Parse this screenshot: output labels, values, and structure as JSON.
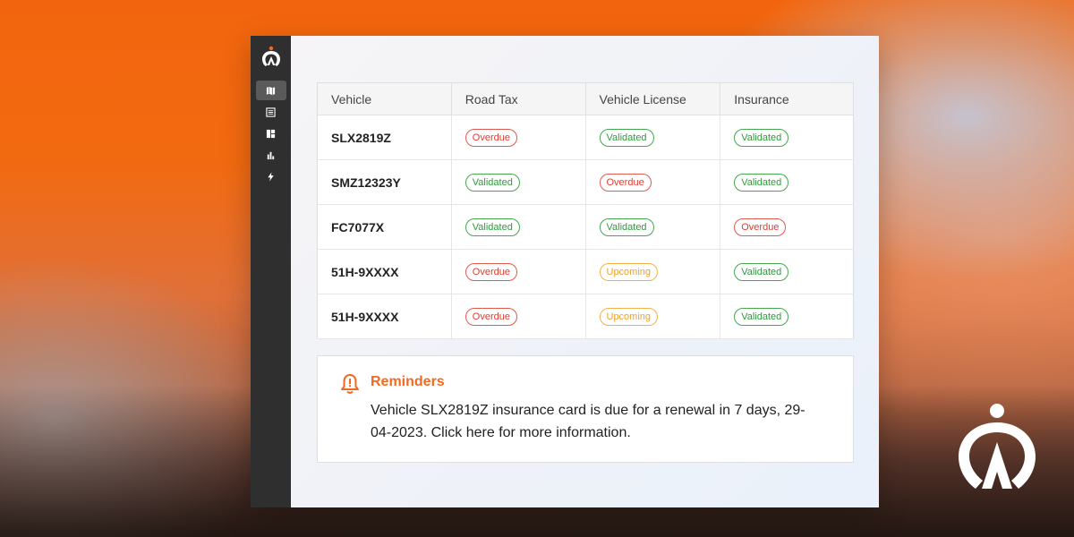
{
  "sidebar": {
    "logo_icon": "app-logo-icon",
    "items": [
      {
        "icon": "map-icon",
        "active": true
      },
      {
        "icon": "list-icon",
        "active": false
      },
      {
        "icon": "dashboard-icon",
        "active": false
      },
      {
        "icon": "bar-chart-icon",
        "active": false
      },
      {
        "icon": "lightning-icon",
        "active": false
      }
    ]
  },
  "table": {
    "headers": [
      "Vehicle",
      "Road Tax",
      "Vehicle License",
      "Insurance"
    ],
    "rows": [
      {
        "vehicle": "SLX2819Z",
        "road_tax": "Overdue",
        "vehicle_license": "Validated",
        "insurance": "Validated"
      },
      {
        "vehicle": "SMZ12323Y",
        "road_tax": "Validated",
        "vehicle_license": "Overdue",
        "insurance": "Validated"
      },
      {
        "vehicle": "FC7077X",
        "road_tax": "Validated",
        "vehicle_license": "Validated",
        "insurance": "Overdue"
      },
      {
        "vehicle": "51H-9XXXX",
        "road_tax": "Overdue",
        "vehicle_license": "Upcoming",
        "insurance": "Validated"
      },
      {
        "vehicle": "51H-9XXXX",
        "road_tax": "Overdue",
        "vehicle_license": "Upcoming",
        "insurance": "Validated"
      }
    ]
  },
  "reminder": {
    "icon": "bell-icon",
    "title": "Reminders",
    "text": "Vehicle SLX2819Z insurance card is due for a renewal in 7 days, 29-04-2023. Click here for more information."
  },
  "colors": {
    "accent": "#f26a21",
    "overdue": "#e03b2e",
    "validated": "#2f9a3c",
    "upcoming": "#f0a128",
    "sidebar": "#2f2f2f"
  }
}
